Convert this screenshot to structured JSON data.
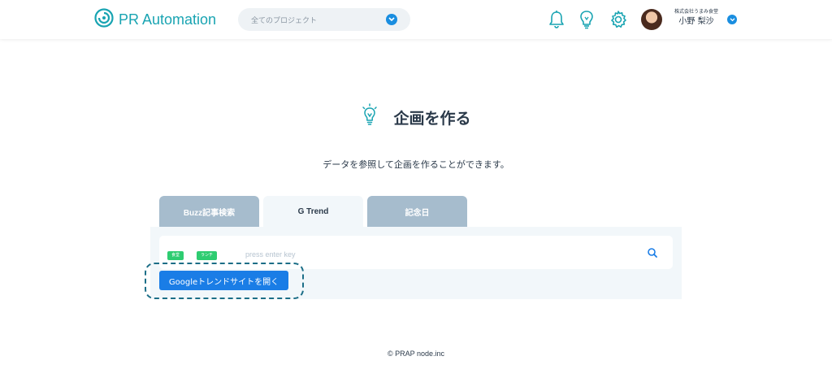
{
  "header": {
    "app_name": "PR Automation",
    "project_select": {
      "placeholder": "全てのプロジェクト"
    },
    "icons": [
      "bell-icon",
      "lightbulb-icon",
      "gear-icon"
    ],
    "user": {
      "company": "株式会社うまみ食堂",
      "name": "小野 梨沙"
    }
  },
  "main": {
    "title": "企画を作る",
    "subtitle": "データを参照して企画を作ることができます。",
    "tabs": [
      {
        "label": "Buzz記事検索",
        "active": false
      },
      {
        "label": "G Trend",
        "active": true
      },
      {
        "label": "記念日",
        "active": false
      }
    ],
    "search": {
      "tags": [
        "食堂",
        "ランチ"
      ],
      "placeholder": "press enter key"
    },
    "google_button": "Googleトレンドサイトを開く"
  },
  "footer": {
    "copyright": "© PRAP node.inc"
  },
  "colors": {
    "brand": "#19a4b2",
    "accent": "#1a7de6",
    "tab_inactive": "#a6bccd",
    "tag": "#2ecc71"
  }
}
